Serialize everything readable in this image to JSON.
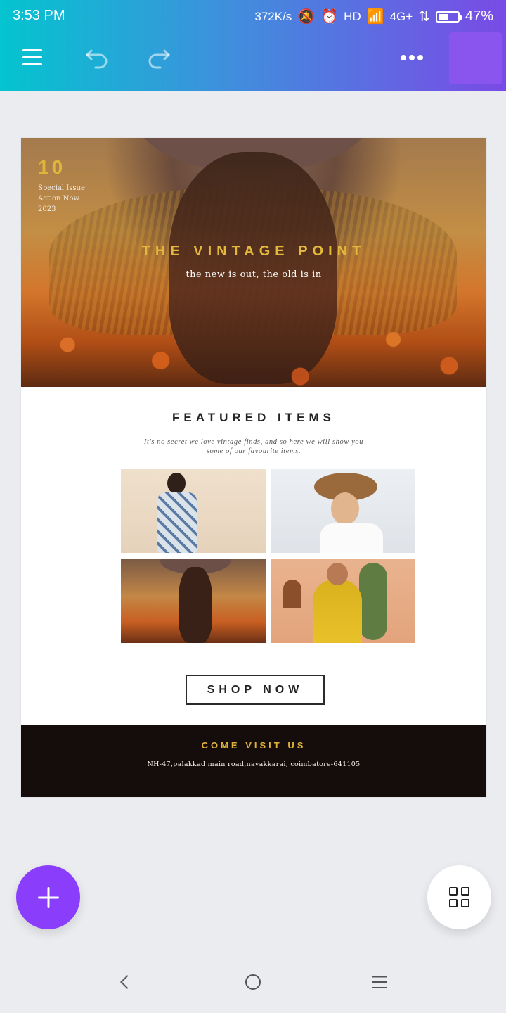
{
  "status_bar": {
    "time": "3:53 PM",
    "speed": "372K/s",
    "hd": "HD",
    "network": "4G+",
    "battery": "47%",
    "battery_level": 0.47
  },
  "toolbar": {
    "icons": [
      "menu-icon",
      "undo-icon",
      "redo-icon",
      "more-icon"
    ],
    "accent_color": "#8a55ee"
  },
  "design": {
    "hero": {
      "issue_number": "10",
      "issue_line1": "Special Issue",
      "issue_line2": "Action Now",
      "issue_line3": "2023",
      "title": "THE VINTAGE POINT",
      "subtitle": "the new is out, the old is in"
    },
    "featured": {
      "title": "FEATURED ITEMS",
      "description": "It's no secret we love vintage finds, and so here we will show you some of our favourite items."
    },
    "shop_button": "SHOP NOW",
    "footer": {
      "heading": "COME VISIT US",
      "address": "NH-47,palakkad main road,navakkarai, coimbatore-641105"
    },
    "colors": {
      "gold": "#e3b83b",
      "footer_bg": "#140d0b"
    }
  },
  "fabs": {
    "add_color": "#8a3dfa",
    "icons": [
      "plus-icon",
      "grid-icon"
    ]
  },
  "navigation": {
    "icons": [
      "back-icon",
      "home-icon",
      "recents-icon"
    ]
  }
}
